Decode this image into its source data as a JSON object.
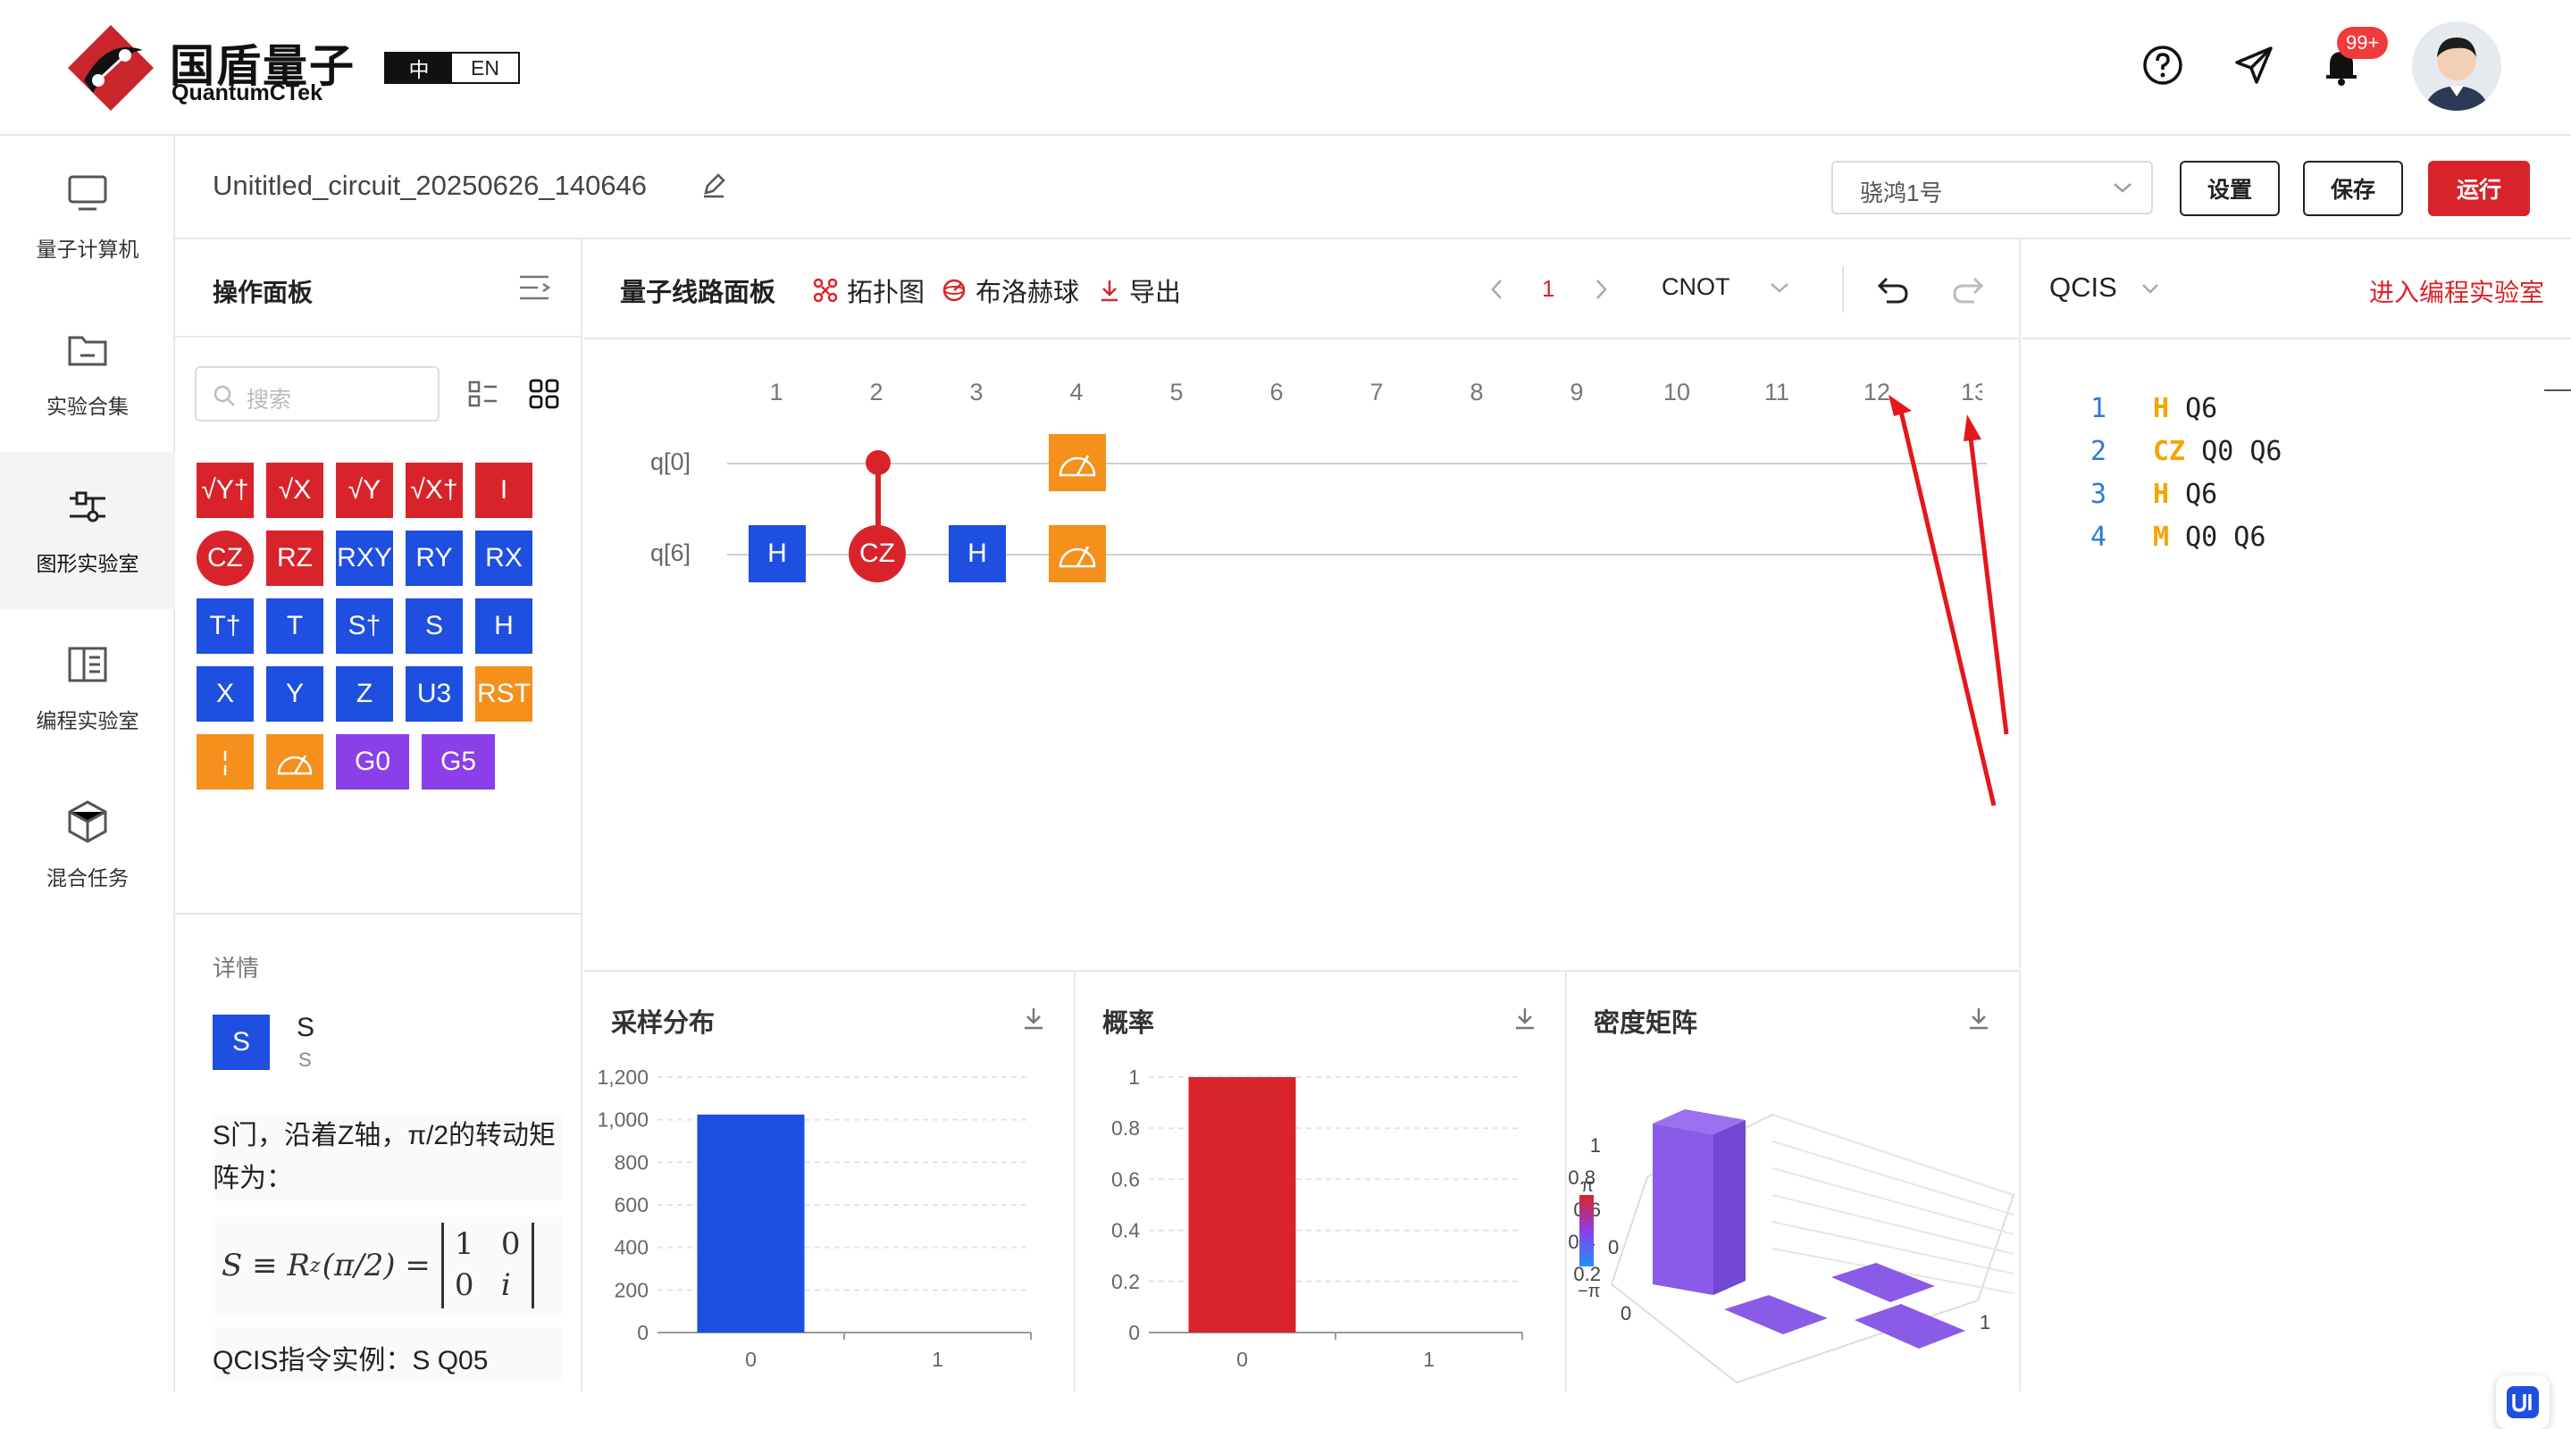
{
  "header": {
    "brand_cn": "国盾量子",
    "brand_en": "QuantumCTek",
    "lang": [
      "中",
      "EN"
    ],
    "badge": "99+",
    "colors": {
      "accent": "#d9232b",
      "blue": "#1f4fe0",
      "orange": "#f5901c",
      "purple": "#8b3fe8"
    }
  },
  "sidebar": {
    "items": [
      {
        "label": "量子计算机",
        "icon": "monitor-icon"
      },
      {
        "label": "实验合集",
        "icon": "folder-icon"
      },
      {
        "label": "图形实验室",
        "icon": "circuit-icon"
      },
      {
        "label": "编程实验室",
        "icon": "book-icon"
      },
      {
        "label": "混合任务",
        "icon": "cube-icon"
      }
    ],
    "active_index": 2
  },
  "titlebar": {
    "circuit_name": "Unititled_circuit_20250626_140646",
    "device": "骁鸿1号",
    "settings": "设置",
    "save": "保存",
    "run": "运行"
  },
  "ops": {
    "title": "操作面板",
    "search_placeholder": "搜索",
    "gates": [
      [
        "√Y†",
        "√X",
        "√Y",
        "√X†",
        "I"
      ],
      [
        "CZ",
        "RZ",
        "RXY",
        "RY",
        "RX"
      ],
      [
        "T†",
        "T",
        "S†",
        "S",
        "H"
      ],
      [
        "X",
        "Y",
        "Z",
        "U3",
        "RST"
      ],
      [
        "¦",
        "",
        "G0",
        "G5"
      ]
    ]
  },
  "detail": {
    "title": "详情",
    "gate_symbol": "S",
    "gate_name": "S",
    "gate_sub": "S",
    "desc": "S门，沿着Z轴，π/2的转动矩阵为：",
    "formula_lhs": "S ≡ R",
    "formula_sub": "z",
    "formula_arg": "(π/2) =",
    "matrix": [
      "1",
      "0",
      "0",
      "i"
    ],
    "example": "QCIS指令实例：S Q05"
  },
  "circuit": {
    "tabs": [
      "量子线路面板",
      "拓扑图",
      "布洛赫球",
      "导出"
    ],
    "page": "1",
    "gate_select": "CNOT",
    "columns": [
      "1",
      "2",
      "3",
      "4",
      "5",
      "6",
      "7",
      "8",
      "9",
      "10",
      "11",
      "12",
      "13"
    ],
    "qubits": [
      "q[0]",
      "q[6]"
    ],
    "gates": [
      {
        "label": "H",
        "col": 1,
        "row": 1
      },
      {
        "label": "CZ",
        "col": 2,
        "row": 1
      },
      {
        "label": "H",
        "col": 3,
        "row": 1
      }
    ]
  },
  "qcis": {
    "title": "QCIS",
    "link": "进入编程实验室",
    "lines": [
      {
        "n": "1",
        "op": "H",
        "args": "Q6"
      },
      {
        "n": "2",
        "op": "CZ",
        "args": "Q0 Q6"
      },
      {
        "n": "3",
        "op": "H",
        "args": "Q6"
      },
      {
        "n": "4",
        "op": "M",
        "args": "Q0 Q6"
      }
    ]
  },
  "chart_data": [
    {
      "type": "bar",
      "title": "采样分布",
      "categories": [
        "0",
        "1"
      ],
      "values": [
        1024,
        0
      ],
      "yticks": [
        "0",
        "200",
        "400",
        "600",
        "800",
        "1,000",
        "1,200"
      ],
      "ylim": [
        0,
        1200
      ],
      "color": "#1f4fe0"
    },
    {
      "type": "bar",
      "title": "概率",
      "categories": [
        "0",
        "1"
      ],
      "values": [
        1,
        0
      ],
      "yticks": [
        "0",
        "0.2",
        "0.4",
        "0.6",
        "0.8",
        "1"
      ],
      "ylim": [
        0,
        1
      ],
      "color": "#d9232b"
    },
    {
      "type": "bar3d",
      "title": "密度矩阵",
      "zticks": [
        "0",
        "0.2",
        "0.4",
        "0.6",
        "0.8",
        "1"
      ],
      "axis_labels": [
        "0",
        "1"
      ],
      "colorbar": [
        "π",
        "−π"
      ],
      "values": [
        [
          1,
          0
        ],
        [
          0,
          0
        ]
      ]
    }
  ]
}
